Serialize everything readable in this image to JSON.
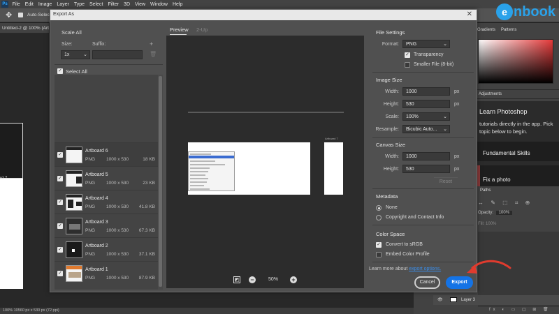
{
  "photoshop": {
    "menu": [
      "File",
      "Edit",
      "Image",
      "Layer",
      "Type",
      "Select",
      "Filter",
      "3D",
      "View",
      "Window",
      "Help"
    ],
    "options_bar_label": "Auto-Select",
    "doc_tab": "Untitled-2 @ 100% (Art",
    "canvas_artboard_label": "rd 7",
    "status": "100%    10560 px x 530 px (72 ppi)",
    "right_panel": {
      "tabs": [
        "Gradients",
        "Patterns"
      ],
      "adjustments_tab": "Adjustments",
      "learn_title": "Learn Photoshop",
      "learn_desc": "tutorials directly in the app. Pick topic below to begin.",
      "learn_card1": "Fundamental Skills",
      "learn_card2": "Fix a photo",
      "paths_tab": "Paths",
      "opacity_label": "Opacity:",
      "opacity_value": "100%",
      "fill_label": "Fill:",
      "fill_value": "100%",
      "layer6_label": "r 6",
      "layer3_label": "Layer 3",
      "layer_tool_icons": "↔ ✎ ⬚ ⌗ ⊕",
      "bottom_icons": "fx ◐ ▭ ▢ ⊞ 🗑"
    },
    "brand_mark": "e",
    "brand_text": "nbook"
  },
  "dialog": {
    "title": "Export As",
    "close_glyph": "✕",
    "left": {
      "scale_all": "Scale All",
      "size_label": "Size:",
      "suffix_label": "Suffix:",
      "plus": "+",
      "size_value": "1x",
      "select_all": "Select All",
      "artboards": [
        {
          "name": "Artboard 6",
          "format": "PNG",
          "dims": "1000 x 530",
          "size": "18 KB",
          "checked": true
        },
        {
          "name": "Artboard 5",
          "format": "PNG",
          "dims": "1000 x 530",
          "size": "23 KB",
          "checked": true
        },
        {
          "name": "Artboard 4",
          "format": "PNG",
          "dims": "1000 x 530",
          "size": "41.8 KB",
          "checked": true
        },
        {
          "name": "Artboard 3",
          "format": "PNG",
          "dims": "1000 x 530",
          "size": "67.3 KB",
          "checked": true
        },
        {
          "name": "Artboard 2",
          "format": "PNG",
          "dims": "1000 x 530",
          "size": "37.1 KB",
          "checked": true
        },
        {
          "name": "Artboard 1",
          "format": "PNG",
          "dims": "1000 x 530",
          "size": "87.9 KB",
          "checked": true
        }
      ]
    },
    "preview": {
      "tab_preview": "Preview",
      "tab_2up": "2-Up",
      "zoom": "50%",
      "second_artboard_label": "Artboard 7"
    },
    "right": {
      "file_settings": "File Settings",
      "format_label": "Format:",
      "format_value": "PNG",
      "transparency": "Transparency",
      "smaller_file": "Smaller File (8-bit)",
      "image_size": "Image Size",
      "width_label": "Width:",
      "width_value": "1000",
      "height_label": "Height:",
      "height_value": "530",
      "px": "px",
      "scale_label": "Scale:",
      "scale_value": "100%",
      "resample_label": "Resample:",
      "resample_value": "Bicubic Auto...",
      "canvas_size": "Canvas Size",
      "canvas_width_value": "1000",
      "canvas_height_value": "530",
      "reset": "Reset",
      "metadata": "Metadata",
      "meta_none": "None",
      "meta_copyright": "Copyright and Contact Info",
      "color_space": "Color Space",
      "convert_srgb": "Convert to sRGB",
      "embed_profile": "Embed Color Profile"
    },
    "footer": {
      "learn_more": "Learn more about",
      "export_options": "export options.",
      "cancel": "Cancel",
      "export": "Export"
    }
  },
  "colors": {
    "accent_blue": "#1473e6",
    "link_blue": "#3b8eea",
    "annotation_red": "#e03b2e",
    "brand_blue": "#2aa2ea"
  }
}
